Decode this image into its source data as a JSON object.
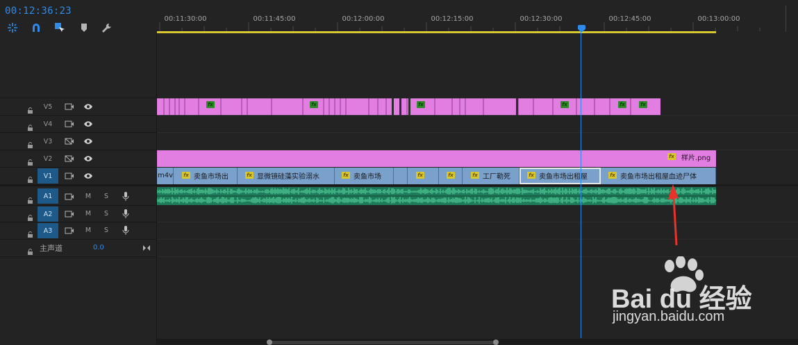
{
  "timecode": "00:12:36:23",
  "toolbar": {
    "icons": [
      "ripple-icon",
      "snap-magnet-icon",
      "linked-select-icon",
      "marker-icon",
      "wrench-icon"
    ]
  },
  "ruler": {
    "labels": [
      "00:11:30:00",
      "00:11:45:00",
      "00:12:00:00",
      "00:12:15:00",
      "00:12:30:00",
      "00:12:45:00",
      "00:13:00:00"
    ]
  },
  "tracks": {
    "video": [
      {
        "name": "V5",
        "selected": false
      },
      {
        "name": "V4",
        "selected": false
      },
      {
        "name": "V3",
        "selected": false
      },
      {
        "name": "V2",
        "selected": false
      },
      {
        "name": "V1",
        "selected": true
      }
    ],
    "audio": [
      {
        "name": "A1",
        "m": "M",
        "s": "S"
      },
      {
        "name": "A2",
        "m": "M",
        "s": "S"
      },
      {
        "name": "A3",
        "m": "M",
        "s": "S"
      }
    ],
    "master": {
      "label": "主声道",
      "value": "0.0"
    }
  },
  "clips": {
    "fx_badge": "fx",
    "v2_label": "样片.png",
    "v1": [
      {
        "label": "m4v",
        "fx": false
      },
      {
        "label": "卖鱼市场出",
        "fx": true
      },
      {
        "label": "显微镜硅藻实验溺水",
        "fx": true
      },
      {
        "label": "卖鱼市场",
        "fx": true
      },
      {
        "label": "",
        "fx": true
      },
      {
        "label": "",
        "fx": true
      },
      {
        "label": "工厂勒死",
        "fx": true
      },
      {
        "label": "卖鱼市场出租屋",
        "fx": true
      },
      {
        "label": "卖鱼市场出租屋血迹尸体",
        "fx": true
      }
    ]
  },
  "watermark": {
    "brand": "Bai du 经验",
    "url": "jingyan.baidu.com"
  },
  "colors": {
    "accent": "#2d8ceb",
    "clip_pink": "#e27de1",
    "clip_blue": "#7aa0cc",
    "audio_green": "#1f7a5a",
    "work_area": "#d9c930",
    "arrow": "#e8322a"
  }
}
